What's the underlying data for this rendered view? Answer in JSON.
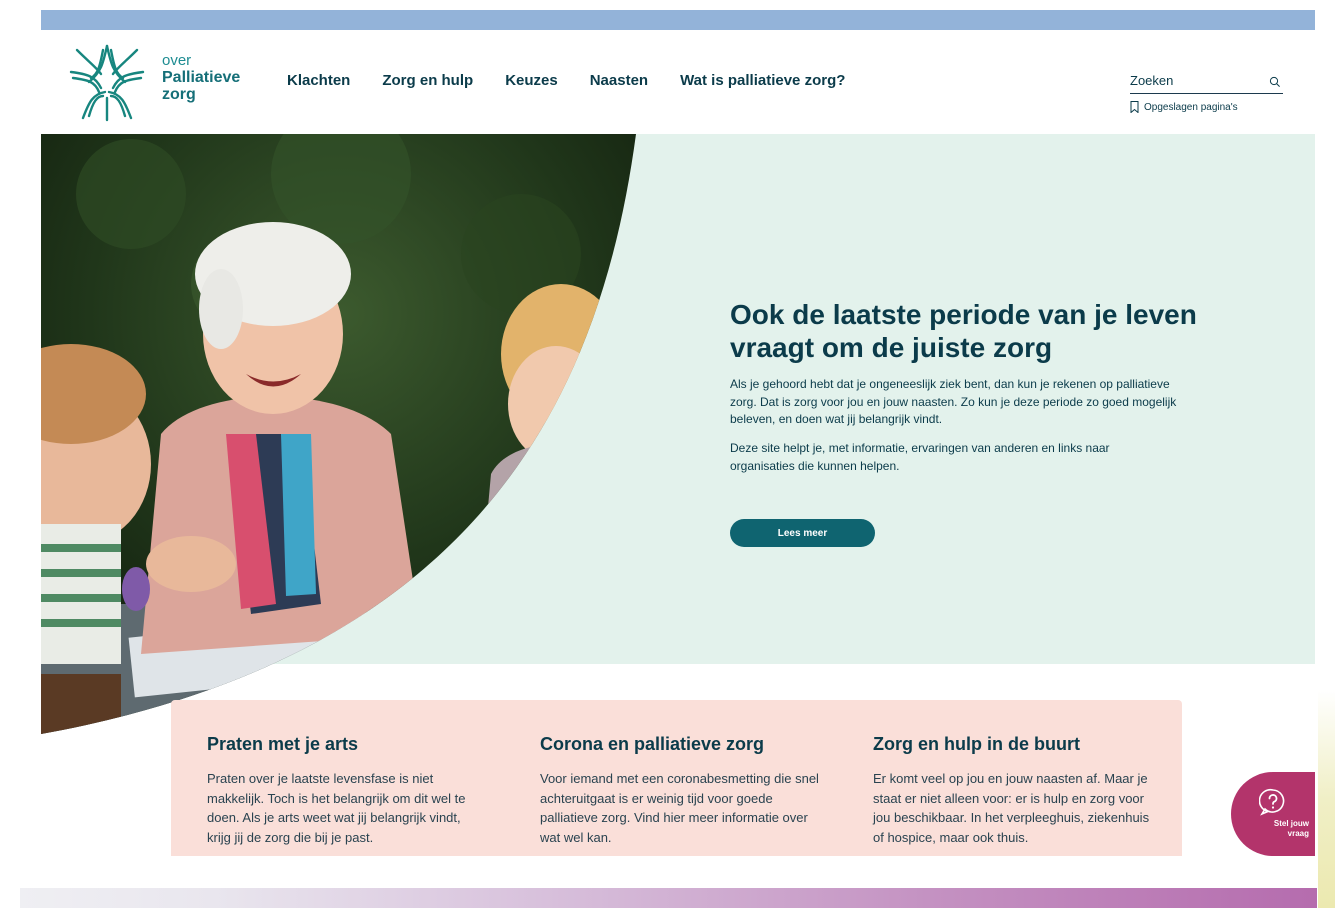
{
  "brand": {
    "logo_line1": "over",
    "logo_line2": "Palliatieve",
    "logo_line3": "zorg",
    "primary_color": "#0f6470",
    "heading_color": "#0b3b4a",
    "hero_bg": "#e3f2ec",
    "card_bg": "#fadfd9",
    "accent_magenta": "#b3346b",
    "topbar_color": "#93b3d9"
  },
  "nav": {
    "items": [
      {
        "label": "Klachten"
      },
      {
        "label": "Zorg en hulp"
      },
      {
        "label": "Keuzes"
      },
      {
        "label": "Naasten"
      },
      {
        "label": "Wat is palliatieve zorg?"
      }
    ]
  },
  "search": {
    "placeholder": "Zoeken",
    "icon": "search-icon"
  },
  "saved_pages": {
    "label": "Opgeslagen pagina's",
    "icon": "bookmark-icon"
  },
  "hero": {
    "title": "Ook de laatste periode van je leven vraagt om de juiste zorg",
    "paragraph1": "Als je gehoord hebt dat je ongeneeslijk ziek bent, dan kun je rekenen op palliatieve zorg. Dat is zorg voor jou en jouw naasten. Zo kun je deze periode zo goed mogelijk beleven, en doen wat jij belangrijk vindt.",
    "paragraph2": "Deze site helpt je, met informatie, ervaringen van anderen en links naar organisaties die kunnen helpen.",
    "button_label": "Lees meer"
  },
  "cards": [
    {
      "title": "Praten met je arts",
      "text": "Praten over je laatste levensfase is niet makkelijk. Toch is het belangrijk om dit wel te doen. Als je arts weet wat jij belangrijk vindt, krijg jij de zorg die bij je past."
    },
    {
      "title": "Corona en palliatieve zorg",
      "text": "Voor iemand met een coronabesmetting die snel achteruitgaat is er weinig tijd voor goede palliatieve zorg. Vind hier meer informatie over wat wel kan."
    },
    {
      "title": "Zorg en hulp in de buurt",
      "text": "Er komt veel op jou en jouw naasten af. Maar je staat er niet alleen voor: er is hulp en zorg voor jou beschikbaar. In het verpleeghuis, ziekenhuis of hospice, maar ook thuis."
    }
  ],
  "ask_button": {
    "label": "Stel jouw\nvraag",
    "icon": "question-icon"
  }
}
